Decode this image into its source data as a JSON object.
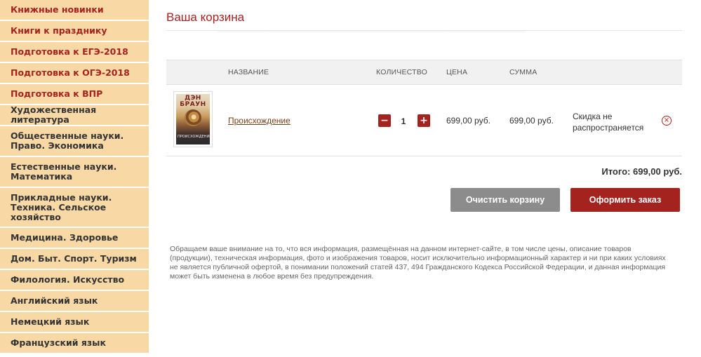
{
  "sidebar": {
    "items": [
      {
        "label": "Книжные новинки",
        "highlight": true
      },
      {
        "label": "Книги к празднику",
        "highlight": true
      },
      {
        "label": "Подготовка к ЕГЭ-2018",
        "highlight": true
      },
      {
        "label": "Подготовка к ОГЭ-2018",
        "highlight": true
      },
      {
        "label": "Подготовка к ВПР",
        "highlight": true
      },
      {
        "label": "Художественная литература",
        "highlight": false
      },
      {
        "label": "Общественные науки. Право. Экономика",
        "highlight": false
      },
      {
        "label": "Естественные науки. Математика",
        "highlight": false
      },
      {
        "label": "Прикладные науки. Техника. Сельское хозяйство",
        "highlight": false
      },
      {
        "label": "Медицина. Здоровье",
        "highlight": false
      },
      {
        "label": "Дом. Быт. Спорт. Туризм",
        "highlight": false
      },
      {
        "label": "Филология. Искусство",
        "highlight": false
      },
      {
        "label": "Английский язык",
        "highlight": false
      },
      {
        "label": "Немецкий язык",
        "highlight": false
      },
      {
        "label": "Французский язык",
        "highlight": false
      }
    ]
  },
  "cart": {
    "title": "Ваша корзина",
    "columns": {
      "name": "НАЗВАНИЕ",
      "quantity": "КОЛИЧЕСТВО",
      "price": "ЦЕНА",
      "sum": "СУММА"
    },
    "items": [
      {
        "cover_author": "ДЭН БРАУН",
        "cover_title": "ПРОИСХОЖДЕНИЕ",
        "name": "Происхождение",
        "quantity": "1",
        "price": "699,00 руб.",
        "sum": "699,00 руб.",
        "discount": "Скидка не распространяется"
      }
    ],
    "minus_label": "−",
    "plus_label": "+",
    "remove_label": "×",
    "total": "Итого: 699,00 руб.",
    "clear_button": "Очистить корзину",
    "order_button": "Оформить заказ",
    "notice": "Обращаем ваше внимание на то, что вся информация, размещённая на данном интернет-сайте, в том числе цены, описание товаров (продукции), техническая информация, фото и изображения товаров, носит исключительно информационный характер и ни при каких условиях не является публичной офертой, в понимании положений статей 437, 494 Гражданского Кодекса Российской Федерации, и данная информация может быть изменена в любое время без предупреждения."
  },
  "colors": {
    "accent": "#a5231f",
    "sidebar_bg": "#f8d9a6",
    "clear_button_bg": "#8c8c8c"
  }
}
